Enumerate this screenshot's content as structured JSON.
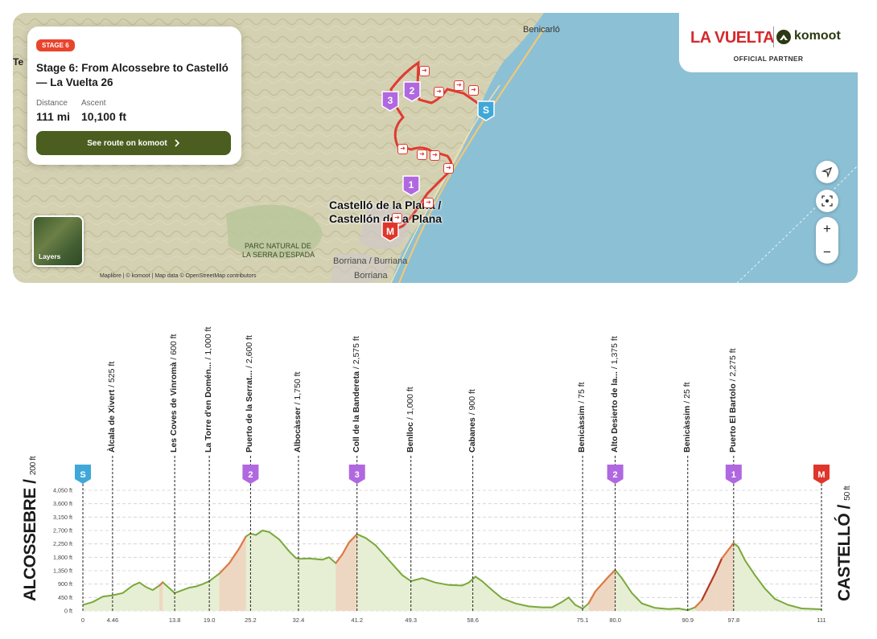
{
  "map": {
    "labels": {
      "benicarlo": "Benicarló",
      "te": "Te",
      "parc_line1": "PARC NATURAL DE",
      "parc_line2": "LA SERRA D'ESPADÀ",
      "borriana1": "Borriana / Burriana",
      "borriana2": "Borriana",
      "city_line1": "Castelló de la Plana /",
      "city_line2": "Castellón de la Plana"
    },
    "markers": {
      "start": "S",
      "finish": "M",
      "kom3": "3",
      "kom2": "2",
      "kom1": "1"
    },
    "attribution": "Maplibre | © komoot | Map data © OpenStreetMap contributors",
    "layers_label": "Layers",
    "colors": {
      "sea": "#8cc0d5",
      "land": "#d3d0b1",
      "route": "#e03a32",
      "park": "#b9c79a"
    }
  },
  "card": {
    "badge": "STAGE 6",
    "title": "Stage 6: From Alcossebre to Castelló — La Vuelta 26",
    "distance_label": "Distance",
    "distance_value": "111 mi",
    "ascent_label": "Ascent",
    "ascent_value": "10,100 ft",
    "button_label": "See route on komoot",
    "button_icon": "chevron-right-icon",
    "button_color": "#4b5e1f",
    "badge_color": "#e8452c"
  },
  "partner": {
    "la_vuelta": "LA VUELTA",
    "komoot": "komoot",
    "official": "OFFICIAL PARTNER",
    "la_vuelta_color": "#d6292d",
    "komoot_color": "#2b3a12"
  },
  "controls": {
    "zoom_in": "+",
    "zoom_out": "−",
    "locate_icon": "navigation-arrow-icon",
    "fit_icon": "fit-route-icon"
  },
  "profile": {
    "start_name": "ALCOSSEBRE /",
    "start_elev": "200 ft",
    "end_name": "CASTELLÓ /",
    "end_elev": "50 ft",
    "y_ticks": [
      "4,050 ft",
      "3,600 ft",
      "3,150 ft",
      "2,700 ft",
      "2,250 ft",
      "1,800 ft",
      "1,350 ft",
      "900 ft",
      "450 ft",
      "0 ft"
    ],
    "x_ticks": [
      "0",
      "4.46",
      "13.8",
      "19.0",
      "25.2",
      "32.4",
      "41.2",
      "49.3",
      "58.6",
      "75.1",
      "80.0",
      "90.9",
      "97.8",
      "111"
    ],
    "waypoints": [
      {
        "mi": 4.46,
        "name": "Àlcala de Xivert",
        "elev": "525 ft"
      },
      {
        "mi": 13.8,
        "name": "Les Coves de Vinromà",
        "elev": "600 ft"
      },
      {
        "mi": 19.0,
        "name": "La Torre d'en Domén...",
        "elev": "1,000 ft"
      },
      {
        "mi": 25.2,
        "name": "Puerto de la Serrat...",
        "elev": "2,600 ft",
        "cat": "2"
      },
      {
        "mi": 32.4,
        "name": "Albocàsser",
        "elev": "1,750 ft"
      },
      {
        "mi": 41.2,
        "name": "Coll de la Bandereta",
        "elev": "2,575 ft",
        "cat": "3"
      },
      {
        "mi": 49.3,
        "name": "Benlloc",
        "elev": "1,000 ft"
      },
      {
        "mi": 58.6,
        "name": "Cabanes",
        "elev": "900 ft"
      },
      {
        "mi": 75.1,
        "name": "Benicàssim",
        "elev": "75 ft"
      },
      {
        "mi": 80.0,
        "name": "Alto Desierto de la...",
        "elev": "1,375 ft",
        "cat": "2"
      },
      {
        "mi": 90.9,
        "name": "Benicàssim",
        "elev": "25 ft"
      },
      {
        "mi": 97.8,
        "name": "Puerto El Bartolo",
        "elev": "2,275 ft",
        "cat": "1"
      }
    ],
    "start_marker": "S",
    "finish_marker": "M",
    "elevation_profile": [
      [
        0,
        200
      ],
      [
        1.5,
        300
      ],
      [
        3,
        480
      ],
      [
        4.46,
        525
      ],
      [
        6,
        600
      ],
      [
        7.5,
        850
      ],
      [
        8.5,
        950
      ],
      [
        9.5,
        800
      ],
      [
        10.5,
        700
      ],
      [
        11.5,
        850
      ],
      [
        12,
        960
      ],
      [
        12.8,
        800
      ],
      [
        13.8,
        600
      ],
      [
        15,
        700
      ],
      [
        16,
        780
      ],
      [
        17,
        820
      ],
      [
        18,
        900
      ],
      [
        19,
        1000
      ],
      [
        20.5,
        1250
      ],
      [
        22,
        1600
      ],
      [
        23.5,
        2100
      ],
      [
        24.5,
        2500
      ],
      [
        25.2,
        2600
      ],
      [
        26,
        2550
      ],
      [
        27,
        2700
      ],
      [
        28,
        2650
      ],
      [
        29.5,
        2400
      ],
      [
        31,
        2000
      ],
      [
        32,
        1780
      ],
      [
        32.4,
        1750
      ],
      [
        34,
        1760
      ],
      [
        36,
        1720
      ],
      [
        37,
        1800
      ],
      [
        38,
        1600
      ],
      [
        39,
        1900
      ],
      [
        40,
        2300
      ],
      [
        41.2,
        2575
      ],
      [
        42.5,
        2450
      ],
      [
        44,
        2200
      ],
      [
        46,
        1700
      ],
      [
        48,
        1200
      ],
      [
        49.3,
        1000
      ],
      [
        51,
        1100
      ],
      [
        53,
        950
      ],
      [
        55,
        870
      ],
      [
        57,
        850
      ],
      [
        58,
        950
      ],
      [
        59,
        1150
      ],
      [
        60,
        1000
      ],
      [
        61.5,
        700
      ],
      [
        63,
        420
      ],
      [
        65,
        250
      ],
      [
        67,
        150
      ],
      [
        69,
        120
      ],
      [
        70.5,
        120
      ],
      [
        72,
        300
      ],
      [
        73,
        450
      ],
      [
        74,
        200
      ],
      [
        75.1,
        75
      ],
      [
        76,
        250
      ],
      [
        77,
        650
      ],
      [
        78,
        900
      ],
      [
        79,
        1150
      ],
      [
        80,
        1375
      ],
      [
        81,
        1100
      ],
      [
        82.5,
        600
      ],
      [
        84,
        250
      ],
      [
        86,
        100
      ],
      [
        88,
        60
      ],
      [
        89.5,
        80
      ],
      [
        90.9,
        25
      ],
      [
        92,
        120
      ],
      [
        93,
        350
      ],
      [
        94,
        800
      ],
      [
        95,
        1250
      ],
      [
        96,
        1750
      ],
      [
        97,
        2050
      ],
      [
        97.8,
        2275
      ],
      [
        98.5,
        2150
      ],
      [
        99.5,
        1700
      ],
      [
        101,
        1200
      ],
      [
        102.5,
        750
      ],
      [
        104,
        400
      ],
      [
        106,
        200
      ],
      [
        108,
        80
      ],
      [
        111,
        50
      ]
    ],
    "colors": {
      "line": "#7aa83a",
      "fill": "#e6efd4",
      "steep": "#e07a4a",
      "kom": "#b068e0",
      "start": "#3fa8d8",
      "finish": "#e0352a"
    }
  }
}
